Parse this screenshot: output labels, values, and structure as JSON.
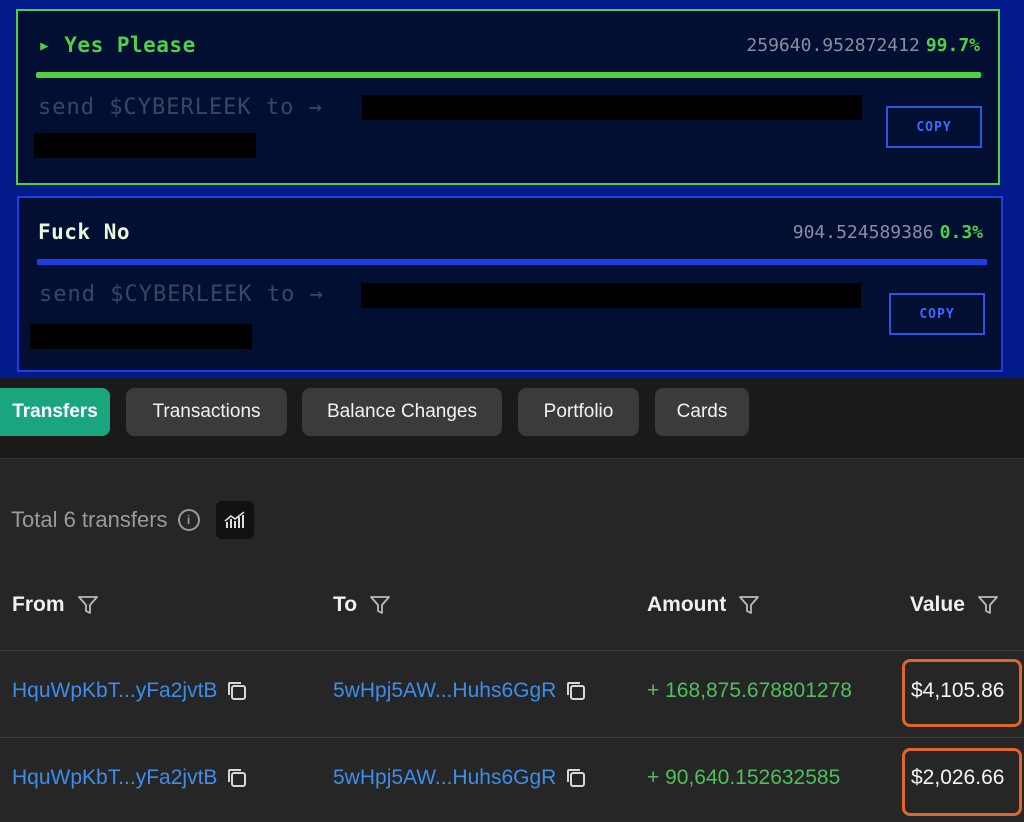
{
  "options": [
    {
      "title": "▸ Yes Please",
      "amount": "259640.952872412",
      "percent": "99.7%",
      "progress": 0.997,
      "send_text": "send $CYBERLEEK to →",
      "copy_label": "COPY"
    },
    {
      "title": "Fuck No",
      "amount": "904.524589386",
      "percent": "0.3%",
      "progress": 0.003,
      "send_text": "send $CYBERLEEK to →",
      "copy_label": "COPY"
    }
  ],
  "tabs": [
    "Transfers",
    "Transactions",
    "Balance Changes",
    "Portfolio",
    "Cards"
  ],
  "active_tab": "Transfers",
  "summary": {
    "total_text": "Total 6 transfers",
    "info_icon": "info-icon",
    "chart_icon": "chart-icon"
  },
  "table": {
    "headers": [
      "From",
      "To",
      "Amount",
      "Value"
    ],
    "rows": [
      {
        "from": "HquWpKbT...yFa2jvtB",
        "to": "5wHpj5AW...Huhs6GgR",
        "amount": "+ 168,875.678801278",
        "value": "$4,105.86"
      },
      {
        "from": "HquWpKbT...yFa2jvtB",
        "to": "5wHpj5AW...Huhs6GgR",
        "amount": "+ 90,640.152632585",
        "value": "$2,026.66"
      }
    ]
  },
  "colors": {
    "yes": "#4fd145",
    "no": "#1d3fe0",
    "active_tab": "#19a67f",
    "address": "#3d8eea",
    "amount": "#4fbf5c",
    "highlight": "#e0662a"
  }
}
